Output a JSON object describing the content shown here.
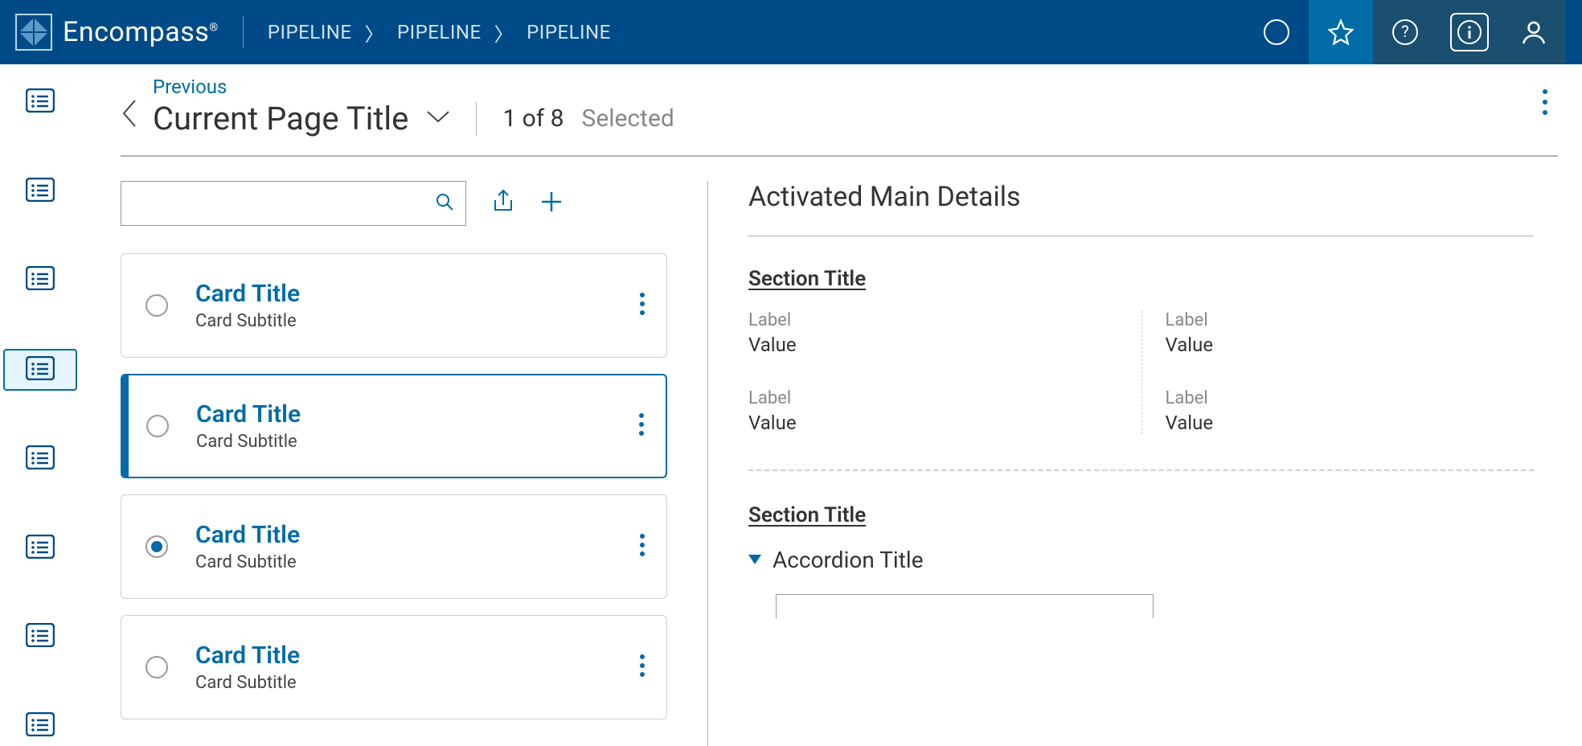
{
  "header": {
    "brand": "Encompass",
    "breadcrumbs": [
      "PIPELINE",
      "PIPELINE",
      "PIPELINE"
    ]
  },
  "page": {
    "previous": "Previous",
    "title": "Current Page Title",
    "count": "1 of 8",
    "selected": "Selected"
  },
  "cards": [
    {
      "title": "Card Title",
      "subtitle": "Card Subtitle",
      "checked": false,
      "selected": false
    },
    {
      "title": "Card Title",
      "subtitle": "Card Subtitle",
      "checked": false,
      "selected": true
    },
    {
      "title": "Card Title",
      "subtitle": "Card Subtitle",
      "checked": true,
      "selected": false
    },
    {
      "title": "Card Title",
      "subtitle": "Card Subtitle",
      "checked": false,
      "selected": false
    }
  ],
  "details": {
    "title": "Activated Main Details",
    "section1": {
      "title": "Section Title",
      "items": [
        {
          "label": "Label",
          "value": "Value"
        },
        {
          "label": "Label",
          "value": "Value"
        },
        {
          "label": "Label",
          "value": "Value"
        },
        {
          "label": "Label",
          "value": "Value"
        }
      ]
    },
    "section2": {
      "title": "Section Title",
      "accordion": "Accordion Title"
    }
  }
}
